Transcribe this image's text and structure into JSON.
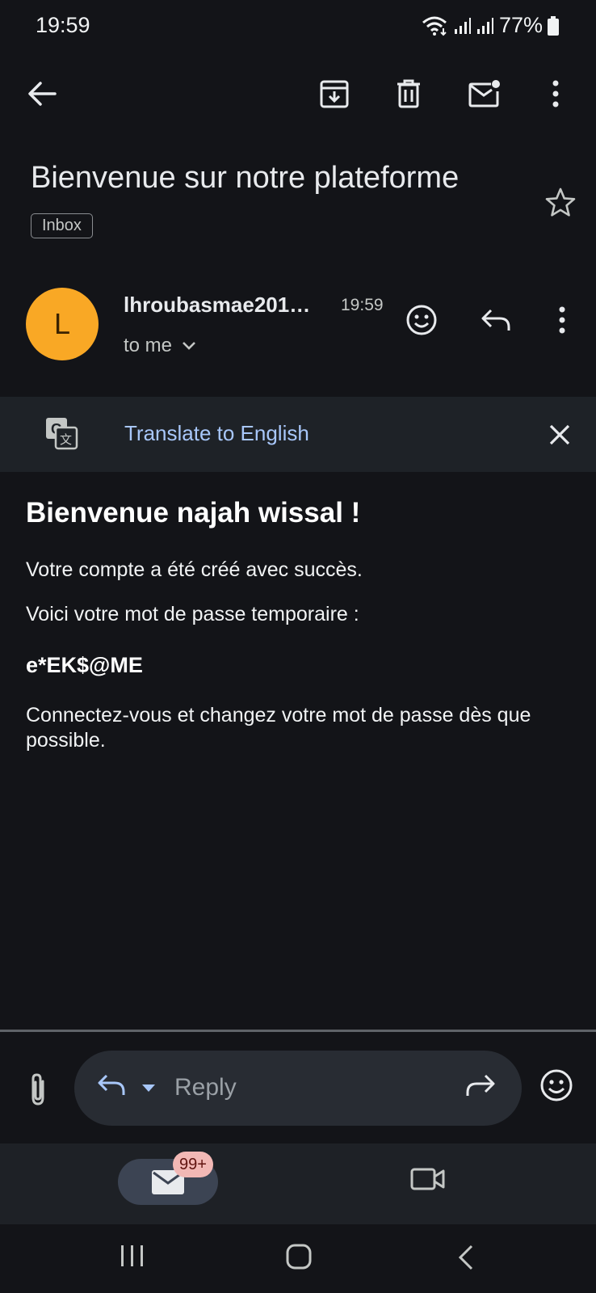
{
  "status_bar": {
    "time": "19:59",
    "battery": "77%"
  },
  "subject": "Bienvenue sur notre plateforme",
  "label_chip": "Inbox",
  "sender": {
    "avatar_letter": "L",
    "avatar_color": "#f9a825",
    "name": "lhroubasmae201…",
    "time": "19:59",
    "recipient": "to me"
  },
  "translate": {
    "link": "Translate to English"
  },
  "body": {
    "greeting": "Bienvenue najah wissal !",
    "line1": "Votre compte a été créé avec succès.",
    "line2": "Voici votre mot de passe temporaire :",
    "password": "e*EK$@ME",
    "line3": "Connectez-vous et changez votre mot de passe dès que possible."
  },
  "reply_bar": {
    "placeholder": "Reply"
  },
  "bottom_nav": {
    "mail_badge": "99+"
  },
  "icons": {
    "toolbar": [
      "back-arrow-icon",
      "archive-icon",
      "delete-icon",
      "mark-unread-icon",
      "more-vert-icon"
    ],
    "sender_actions": [
      "emoji-reaction-icon",
      "reply-icon",
      "more-vert-icon"
    ],
    "translate": [
      "translate-icon",
      "close-icon"
    ],
    "reply_bar": [
      "attachment-icon",
      "reply-icon",
      "caret-down-icon",
      "forward-icon",
      "emoji-icon"
    ],
    "bottom_nav": [
      "mail-icon",
      "video-camera-icon"
    ],
    "system_nav": [
      "recents-icon",
      "home-icon",
      "back-icon"
    ]
  },
  "colors": {
    "background": "#131418",
    "accent_link": "#a8c7fa",
    "badge": "#f2b8b5"
  }
}
